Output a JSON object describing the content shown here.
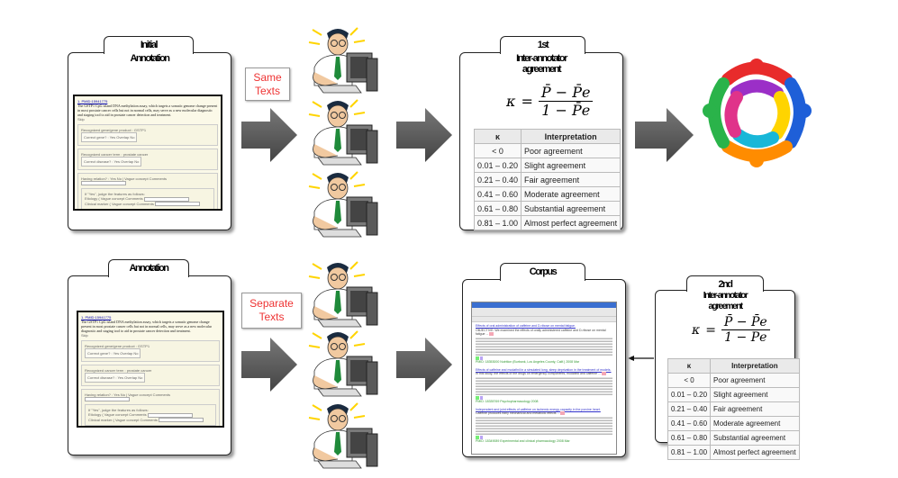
{
  "top": {
    "initial_annotation": {
      "title_line1": "Initial",
      "title_line2": "Annotation"
    },
    "label": {
      "line1": "Same",
      "line2": "Texts"
    },
    "agreement": {
      "title_line1": "1st",
      "title_line2": "Inter-annotator",
      "title_line3": "agreement"
    }
  },
  "bottom": {
    "annotation": {
      "title": "Annotation"
    },
    "label": {
      "line1": "Separate",
      "line2": "Texts"
    },
    "corpus": {
      "title": "Corpus"
    },
    "agreement": {
      "title_line1": "2nd",
      "title_line2": "Inter-annotator",
      "title_line3": "agreement"
    }
  },
  "form": {
    "header": "1. PMID:15941775",
    "intro": "The GSTP1 CpG island DNA methylation assay, which targets a somatic genome change present in most prostate cancer cells but not in normal cells, may serve as a new molecular diagnostic and staging tool to aid in prostate cancer detection and treatment.",
    "skip": "Skip",
    "gene_label": "Recognized gene/gene product : GSTP1",
    "gene_question": "Correct gene? : Yes Overlap No",
    "cancer_label": "Recognized cancer term : prostate cancer",
    "cancer_question": "Correct disease? : Yes Overlap No",
    "relation_question": "Having relation? : Yes No | Vague concept Comments",
    "judge": "If \"Yes\", judge the features as follows:",
    "etiology": "Etiology ( Vague concept Comments",
    "clinical": "Clinical marker ( Vague concept Comments"
  },
  "formula": {
    "kappa": "κ",
    "equals": "=",
    "numerator": "P̄ − P̄e",
    "denominator": "1 − P̄e"
  },
  "kappa_table": {
    "headers": [
      "κ",
      "Interpretation"
    ],
    "rows": [
      [
        "< 0",
        "Poor agreement"
      ],
      [
        "0.01 – 0.20",
        "Slight agreement"
      ],
      [
        "0.21 – 0.40",
        "Fair agreement"
      ],
      [
        "0.41 – 0.60",
        "Moderate agreement"
      ],
      [
        "0.61 – 0.80",
        "Substantial agreement"
      ],
      [
        "0.81 – 1.00",
        "Almost perfect agreement"
      ]
    ]
  },
  "corpus_screen": {
    "entries": [
      {
        "title": "Effects of oral administration of caffeine and D-ribose on mental fatigue.",
        "body": "OBJECTIVE: We examined the effects of orally administered caffeine and D-ribose on mental fatigue ...",
        "source": "PMID: 18353000 Nutrition (Burbank, Los Angeles County, Calif.) 2008 Mar"
      },
      {
        "title": "Effects of caffeine and modafinil in a simulated long, sleep deprivation in the treatment of models.",
        "body": "In this study, the effects of the drugs on emergency components, modafinil and caffeine ...",
        "source": "PMID: 18335769 Psychopharmacology 2008"
      },
      {
        "title": "Independent and joint effects of caffeine on ischemic energy capacity in the porcine heart.",
        "body": "Caffeine produces early mechanical and metabolic effects ...",
        "source": "PMID: 18349089 Experimental and clinical pharmacology 2008 Mar"
      }
    ]
  },
  "colors": {
    "label_text": "#e33333",
    "arrow": "#555555"
  },
  "icons": [
    "person-at-computer-icon",
    "teamwork-logo-icon",
    "arrow-right-icon"
  ]
}
